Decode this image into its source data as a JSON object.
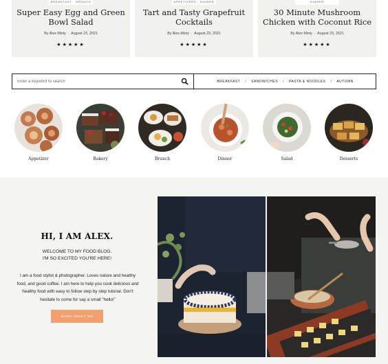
{
  "recipe_cards": [
    {
      "tag": "Breakfast · Brunch",
      "title_line1": "Super Easy Egg and Green",
      "title_line2": "Bowl Salad",
      "author": "By Alex Misty",
      "date": "August 23, 2021",
      "stars": "★★★★★"
    },
    {
      "tag": "Appetizers · Dinner",
      "title_line1": "Tart and Tasty Grapefruit",
      "title_line2": "Cocktails",
      "author": "By Alex Misty",
      "date": "August 23, 2021",
      "stars": "★★★★★"
    },
    {
      "tag": "Dinner",
      "title_line1": "30 Minute Mushroom",
      "title_line2": "Chicken with Coconut Rice",
      "author": "By Alex Misty",
      "date": "August 23, 2021",
      "stars": "★★★★★"
    }
  ],
  "search": {
    "placeholder": "Enter a keyword to search",
    "quick_links": [
      "Breakfast",
      "Sandwiches",
      "Pasta & Noodles",
      "Autumn"
    ],
    "separator": "/"
  },
  "categories": [
    "Appetizer",
    "Bakery",
    "Brunch",
    "Dinner",
    "Salad",
    "Desserts"
  ],
  "about": {
    "title": "HI, I AM ALEX.",
    "welcome_line1": "WELCOME TO MY FOOD BLOG.",
    "welcome_line2": "I'M SO EXCITED YOU'RE HERE!",
    "bio_line1": "I am a food stylist & photographer. Loves nature and healthy",
    "bio_line2": "food, and good coffee. I am here to help you cook delicious and",
    "bio_line3": "healthy food with easy to follow step by step tutorial. Don't",
    "bio_line4": "hesitate to come for say a small \"hello!\"",
    "button_label": "More about me"
  },
  "colors": {
    "accent": "#f2a070",
    "card_bg": "#f1f1ed",
    "section_bg": "#f4f4f1"
  }
}
